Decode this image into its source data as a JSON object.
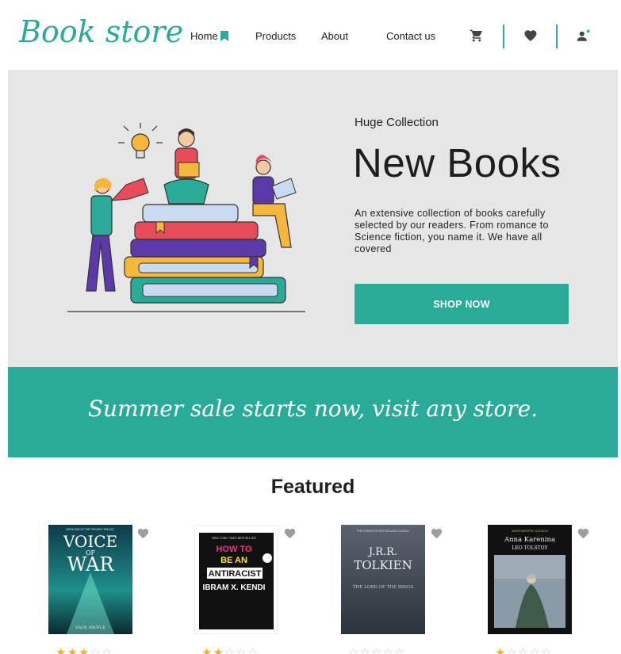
{
  "header": {
    "logo": "Book store",
    "nav": {
      "home": "Home",
      "products": "Products",
      "about": "About",
      "contact": "Contact us"
    }
  },
  "hero": {
    "eyebrow": "Huge Collection",
    "title": "New Books",
    "description": "An extensive collection of books carefully selected by our readers. From romance to Science fiction, you name it. We have all covered",
    "cta": "SHOP NOW"
  },
  "banner": {
    "text": "Summer sale starts now, visit any store."
  },
  "featured": {
    "title": "Featured",
    "books": [
      {
        "cover_title_1": "VOICE",
        "cover_title_2": "OF",
        "cover_title_3": "WAR",
        "cover_author": "ZACK ARGYLE",
        "cover_tagline": "BOOK ONE OF THE THEURGY TRILOGY",
        "rating": 3
      },
      {
        "cover_title_1": "HOW TO",
        "cover_title_2": "BE AN",
        "cover_title_3": "ANTIRACIST",
        "cover_author": "IBRAM X. KENDI",
        "cover_tagline": "NEW YORK TIMES BESTSELLER",
        "rating": 2
      },
      {
        "cover_title_1": "J.R.R.",
        "cover_title_2": "TOLKIEN",
        "cover_title_3": "THE LORD OF THE RINGS",
        "cover_author": "",
        "cover_tagline": "THE COMPLETE BESTSELLING CLASSIC",
        "rating": 0
      },
      {
        "cover_title_1": "Anna Karenina",
        "cover_title_2": "",
        "cover_title_3": "",
        "cover_author": "LEO TOLSTOY",
        "cover_tagline": "WORDSWORTH CLASSICS",
        "rating": 1
      }
    ]
  },
  "colors": {
    "accent": "#2aaa98",
    "hero_bg": "#e6e6e6",
    "star_on": "#f2b01e",
    "star_off": "#c8c8c8"
  },
  "icons": {
    "home": "bookmark-icon",
    "cart": "cart-icon",
    "wishlist": "heart-icon",
    "account": "user-icon",
    "favorite": "heart-icon"
  }
}
